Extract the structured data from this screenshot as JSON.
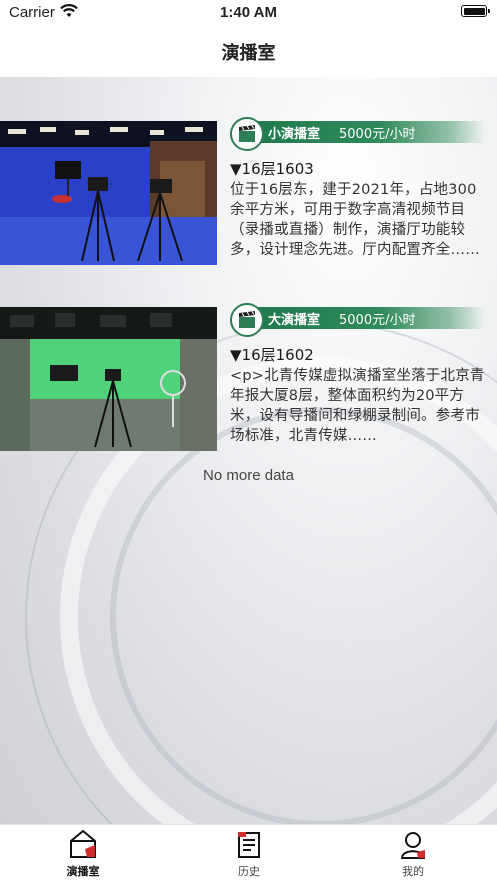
{
  "status_bar": {
    "carrier": "Carrier",
    "time": "1:40 AM"
  },
  "nav": {
    "title": "演播室"
  },
  "rooms": [
    {
      "name": "小演播室",
      "price": "5000元/小时",
      "floor": "▼16层1603",
      "description": "位于16层东，建于2021年，占地300余平方米，可用于数字高清视频节目（录播或直播）制作，演播厅功能较多，设计理念先进。厅内配置齐全……"
    },
    {
      "name": "大演播室",
      "price": "5000元/小时",
      "floor": "▼16层1602",
      "description": "<p>北青传媒虚拟演播室坐落于北京青年报大厦8层，整体面积约为20平方米，设有导播间和绿棚录制间。参考市场标准，北青传媒……"
    }
  ],
  "list_footer": "No more data",
  "tabs": [
    {
      "label": "演播室",
      "icon": "studio-icon",
      "active": true
    },
    {
      "label": "历史",
      "icon": "history-icon",
      "active": false
    },
    {
      "label": "我的",
      "icon": "profile-icon",
      "active": false
    }
  ],
  "colors": {
    "accent_green": "#1f7a4e",
    "tab_accent_red": "#d22c2c"
  }
}
